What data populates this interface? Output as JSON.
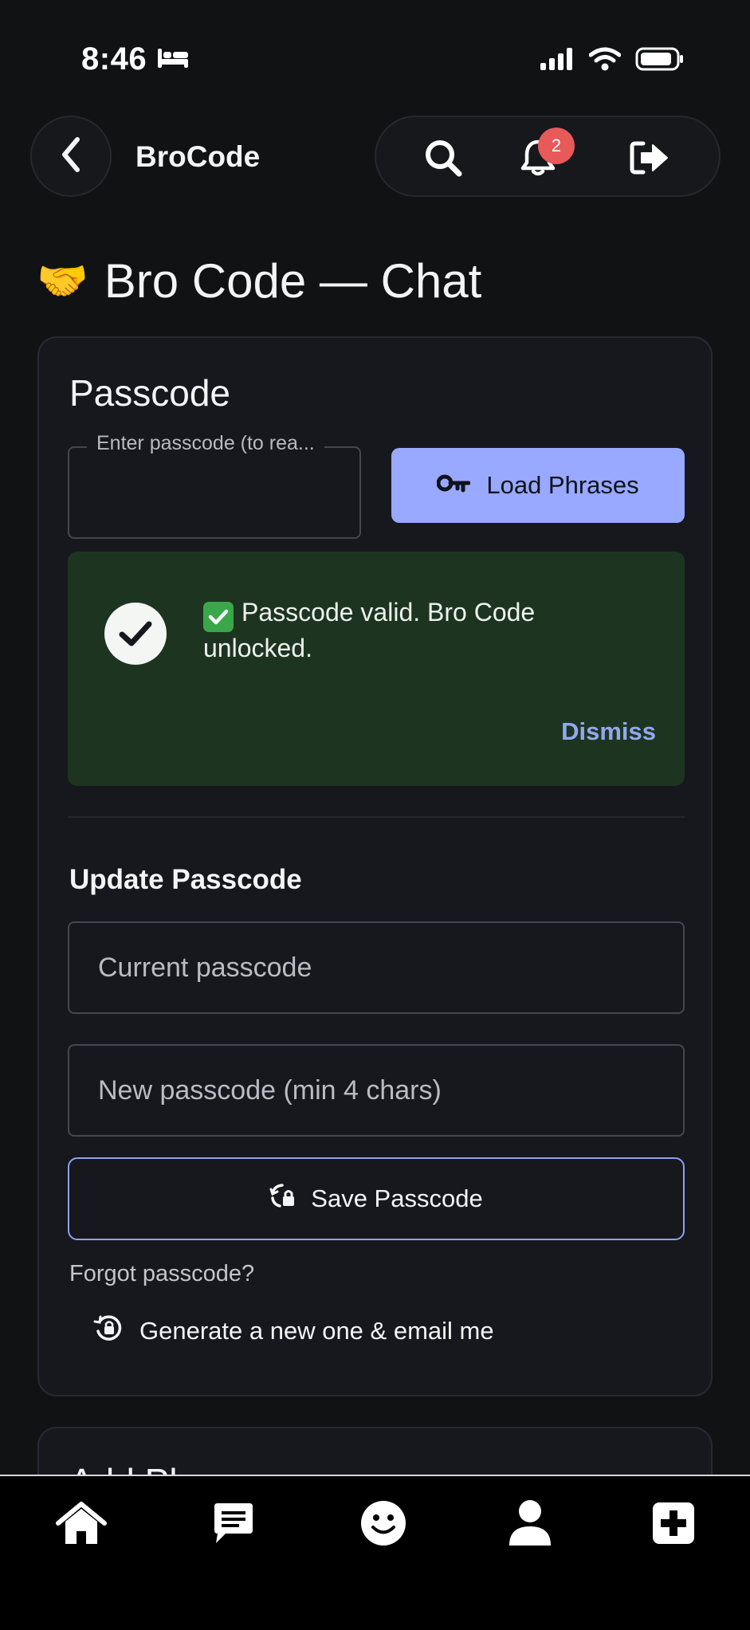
{
  "status_bar": {
    "time": "8:46"
  },
  "header": {
    "app_name": "BroCode",
    "notification_count": "2"
  },
  "page": {
    "title": "Bro Code — Chat",
    "title_emoji": "🤝"
  },
  "passcode_card": {
    "title": "Passcode",
    "passcode_field": {
      "label": "Enter passcode (to rea...",
      "value": ""
    },
    "load_button": "Load Phrases",
    "success": {
      "message": "Passcode valid. Bro Code unlocked.",
      "dismiss": "Dismiss"
    },
    "update": {
      "title": "Update Passcode",
      "current_placeholder": "Current passcode",
      "new_placeholder": "New passcode (min 4 chars)",
      "save_button": "Save Passcode"
    },
    "forgot_text": "Forgot passcode?",
    "generate_link": "Generate a new one & email me"
  },
  "next_card": {
    "title_partial": "Add Ph"
  },
  "bottom_nav": [
    "home",
    "chat",
    "emoji",
    "profile",
    "add"
  ],
  "colors": {
    "background": "#111214",
    "card": "#16181e",
    "accent": "#98a9ff",
    "success_bg": "#1d3520",
    "badge": "#e8595a",
    "link": "#93a8f1"
  }
}
